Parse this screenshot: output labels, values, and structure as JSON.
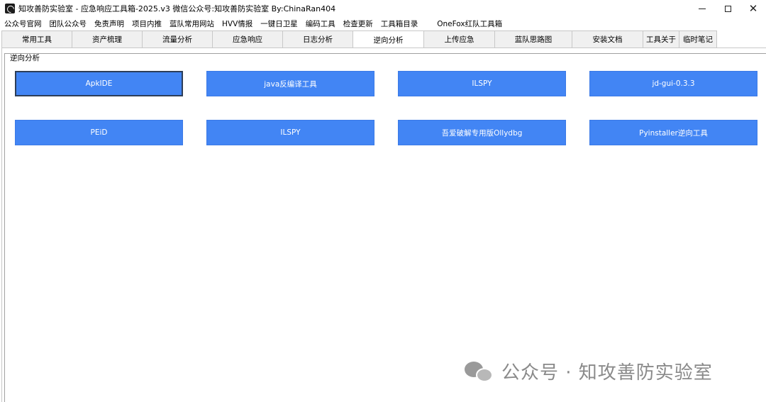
{
  "window": {
    "title": "知攻善防实验室 - 应急响应工具箱-2025.v3    微信公众号:知攻善防实验室   By:ChinaRan404",
    "controls": {
      "minimize": "minimize-icon",
      "maximize": "maximize-icon",
      "close": "✕"
    }
  },
  "menu": {
    "items": [
      "公众号官网",
      "团队公众号",
      "免责声明",
      "项目内推",
      "蓝队常用网站",
      "HVV情报",
      "一键日卫星",
      "编码工具",
      "检查更新",
      "工具箱目录",
      "OneFox红队工具箱"
    ]
  },
  "tabs": [
    {
      "label": "常用工具",
      "active": false
    },
    {
      "label": "资产梳理",
      "active": false
    },
    {
      "label": "流量分析",
      "active": false
    },
    {
      "label": "应急响应",
      "active": false
    },
    {
      "label": "日志分析",
      "active": false
    },
    {
      "label": "逆向分析",
      "active": true
    },
    {
      "label": "上传应急",
      "active": false
    },
    {
      "label": "蓝队思路图",
      "active": false
    },
    {
      "label": "安装文档",
      "active": false
    },
    {
      "label": "工具关于",
      "active": false
    },
    {
      "label": "临时笔记",
      "active": false
    }
  ],
  "group": {
    "legend": "逆向分析",
    "buttons": [
      "ApkIDE",
      "java反编译工具",
      "ILSPY",
      "jd-gui-0.3.3",
      "PEiD",
      "ILSPY",
      "吾爱破解专用版Ollydbg",
      "Pyinstaller逆向工具"
    ]
  },
  "watermark": {
    "text": "公众号 · 知攻善防实验室",
    "icon": "wechat-icon"
  },
  "colors": {
    "button_bg": "#4285f4",
    "button_text": "#ffffff",
    "watermark": "#8a8a8a"
  }
}
